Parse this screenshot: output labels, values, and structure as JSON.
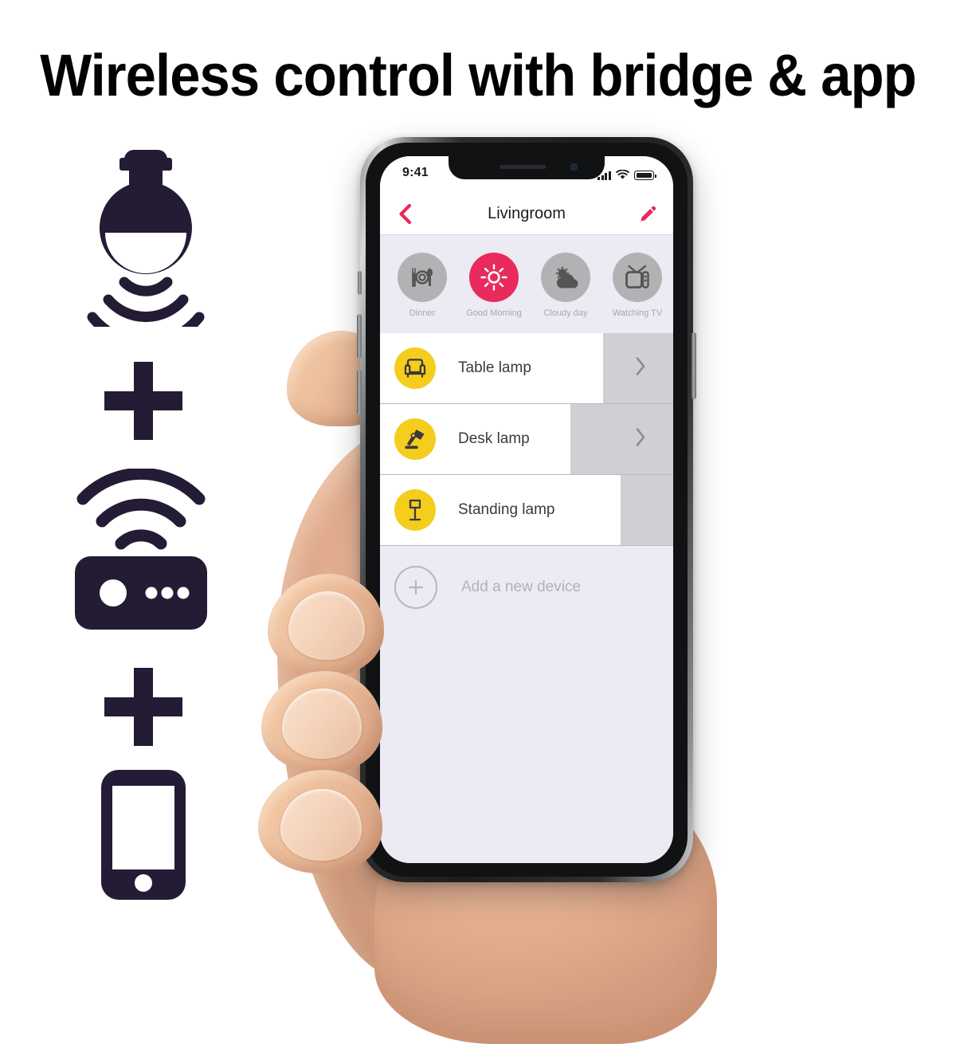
{
  "headline": "Wireless control with bridge & app",
  "colors": {
    "icon_navy": "#241b35",
    "accent_pink": "#e82a5c",
    "device_yellow": "#f4cd1d",
    "scene_gray": "#b2b2b4",
    "screen_bg": "#eceaf2"
  },
  "left_icons": [
    {
      "name": "smart-bulb-wireless-icon",
      "label": "smart bulb broadcasting"
    },
    {
      "name": "plus-icon",
      "label": "plus"
    },
    {
      "name": "bridge-hub-icon",
      "label": "wireless bridge"
    },
    {
      "name": "plus-icon",
      "label": "plus"
    },
    {
      "name": "smartphone-icon",
      "label": "smartphone"
    }
  ],
  "phone": {
    "status_bar": {
      "time": "9:41",
      "cellular_icon": "signal-bars-icon",
      "wifi_icon": "wifi-icon",
      "battery_icon": "battery-full-icon"
    },
    "nav": {
      "back_icon": "chevron-left-icon",
      "title": "Livingroom",
      "edit_icon": "pencil-edit-icon"
    },
    "scenes": [
      {
        "label": "Dinner",
        "icon": "dinner-plate-cutlery-icon",
        "active": false
      },
      {
        "label": "Good Morning",
        "icon": "sun-icon",
        "active": true
      },
      {
        "label": "Cloudy day",
        "icon": "sun-cloud-icon",
        "active": false
      },
      {
        "label": "Watching TV",
        "icon": "television-icon",
        "active": false
      },
      {
        "label": "",
        "icon": "scene-icon-partial",
        "active": false
      }
    ],
    "devices": [
      {
        "name": "Table lamp",
        "icon": "armchair-lamp-icon",
        "brightness_percent": 76,
        "chevron_icon": "chevron-right-icon"
      },
      {
        "name": "Desk lamp",
        "icon": "desk-lamp-icon",
        "brightness_percent": 65,
        "chevron_icon": "chevron-right-icon"
      },
      {
        "name": "Standing lamp",
        "icon": "floor-lamp-icon",
        "brightness_percent": 82,
        "chevron_icon": "chevron-right-icon"
      }
    ],
    "add_device": {
      "label": "Add a new device",
      "icon": "plus-circle-outline-icon"
    }
  }
}
